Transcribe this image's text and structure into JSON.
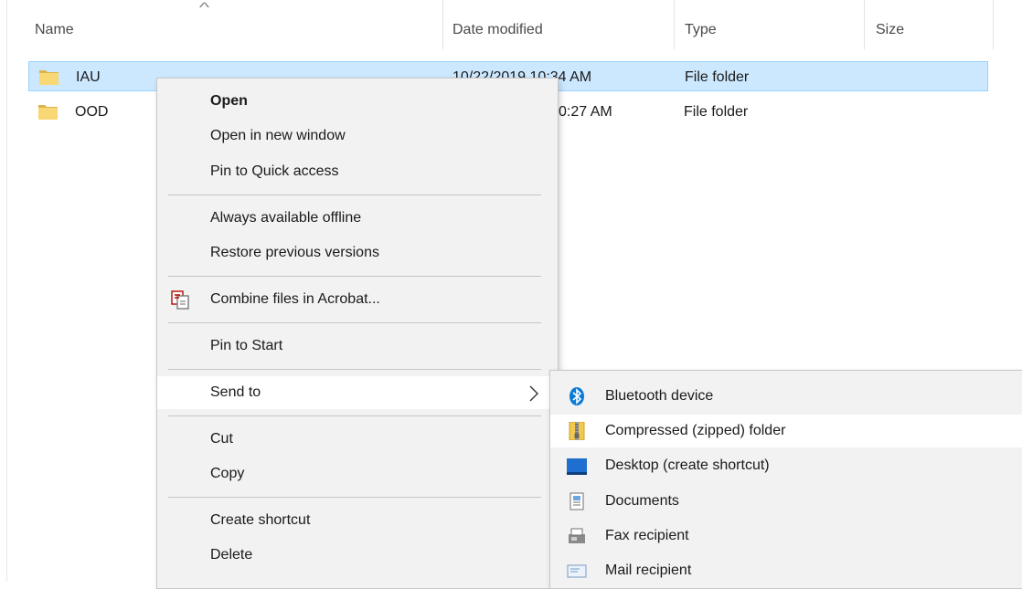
{
  "columns": {
    "name": "Name",
    "date_modified": "Date modified",
    "type": "Type",
    "size": "Size",
    "sort_indicator": "^"
  },
  "files": [
    {
      "name": "IAU",
      "date_modified": "10/22/2019 10:34 AM",
      "date_visible": "10/22/2019 10:34 AM",
      "type": "File folder",
      "icon": "folder-icon",
      "selected": true
    },
    {
      "name": "OOD",
      "date_visible": "0:27 AM",
      "type": "File folder",
      "icon": "folder-icon",
      "selected": false
    }
  ],
  "context_menu": {
    "items": {
      "open": "Open",
      "open_new_window": "Open in new window",
      "pin_quick_access": "Pin to Quick access",
      "always_offline": "Always available offline",
      "restore_versions": "Restore previous versions",
      "combine_acrobat": "Combine files in Acrobat...",
      "pin_start": "Pin to Start",
      "send_to": "Send to",
      "cut": "Cut",
      "copy": "Copy",
      "create_shortcut": "Create shortcut",
      "delete": "Delete"
    },
    "submenu_arrow": ">",
    "acrobat_icon": "acrobat-combine-icon"
  },
  "send_to_menu": {
    "items": {
      "bluetooth": "Bluetooth device",
      "compressed": "Compressed (zipped) folder",
      "desktop": "Desktop (create shortcut)",
      "documents": "Documents",
      "fax": "Fax recipient",
      "mail": "Mail recipient"
    },
    "icons": [
      "bluetooth-icon",
      "zip-folder-icon",
      "desktop-icon",
      "documents-icon",
      "fax-icon",
      "mail-icon"
    ]
  },
  "colors": {
    "selection_bg": "#cce8ff",
    "selection_border": "#99d1ff",
    "menu_bg": "#f2f2f2",
    "menu_hover": "#ffffff",
    "folder_yellow": "#f8d775",
    "bluetooth_blue": "#0a7bd8"
  }
}
